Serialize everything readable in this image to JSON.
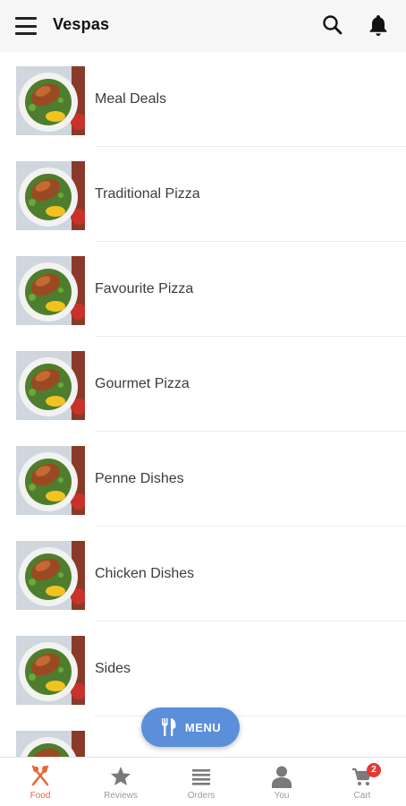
{
  "header": {
    "title": "Vespas",
    "menu_icon": "hamburger-menu-icon",
    "search_icon": "search-icon",
    "notifications_icon": "bell-icon"
  },
  "categories": [
    {
      "label": "Meal Deals"
    },
    {
      "label": "Traditional Pizza"
    },
    {
      "label": "Favourite Pizza"
    },
    {
      "label": "Gourmet Pizza"
    },
    {
      "label": "Penne Dishes"
    },
    {
      "label": "Chicken Dishes"
    },
    {
      "label": "Sides"
    },
    {
      "label": ""
    }
  ],
  "fab": {
    "label": "MENU",
    "icon": "fork-knife-icon",
    "color": "#5b8fd9"
  },
  "bottom_nav": {
    "items": [
      {
        "label": "Food",
        "icon": "fork-knife-icon",
        "active": true
      },
      {
        "label": "Reviews",
        "icon": "star-icon"
      },
      {
        "label": "Orders",
        "icon": "list-icon"
      },
      {
        "label": "You",
        "icon": "person-icon"
      },
      {
        "label": "Cart",
        "icon": "cart-icon",
        "badge": "2"
      }
    ],
    "active_color": "#e6683c",
    "inactive_color": "#9a9a9a",
    "badge_color": "#e53935"
  }
}
